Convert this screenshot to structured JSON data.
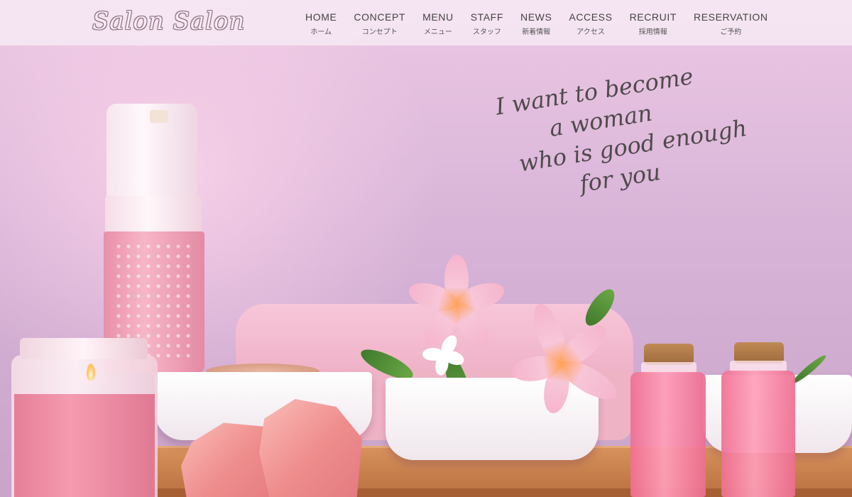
{
  "brand": {
    "logo_text": "Salon Salon"
  },
  "nav": {
    "items": [
      {
        "en": "HOME",
        "jp": "ホーム"
      },
      {
        "en": "CONCEPT",
        "jp": "コンセプト"
      },
      {
        "en": "MENU",
        "jp": "メニュー"
      },
      {
        "en": "STAFF",
        "jp": "スタッフ"
      },
      {
        "en": "NEWS",
        "jp": "新着情報"
      },
      {
        "en": "ACCESS",
        "jp": "アクセス"
      },
      {
        "en": "RECRUIT",
        "jp": "採用情報"
      },
      {
        "en": "RESERVATION",
        "jp": "ご予約"
      }
    ]
  },
  "hero": {
    "tagline": [
      "I want to become",
      "a woman",
      "who is good enough",
      "for you"
    ],
    "colors": {
      "accent": "#f0a0bd",
      "text": "#4f4a4c"
    }
  }
}
